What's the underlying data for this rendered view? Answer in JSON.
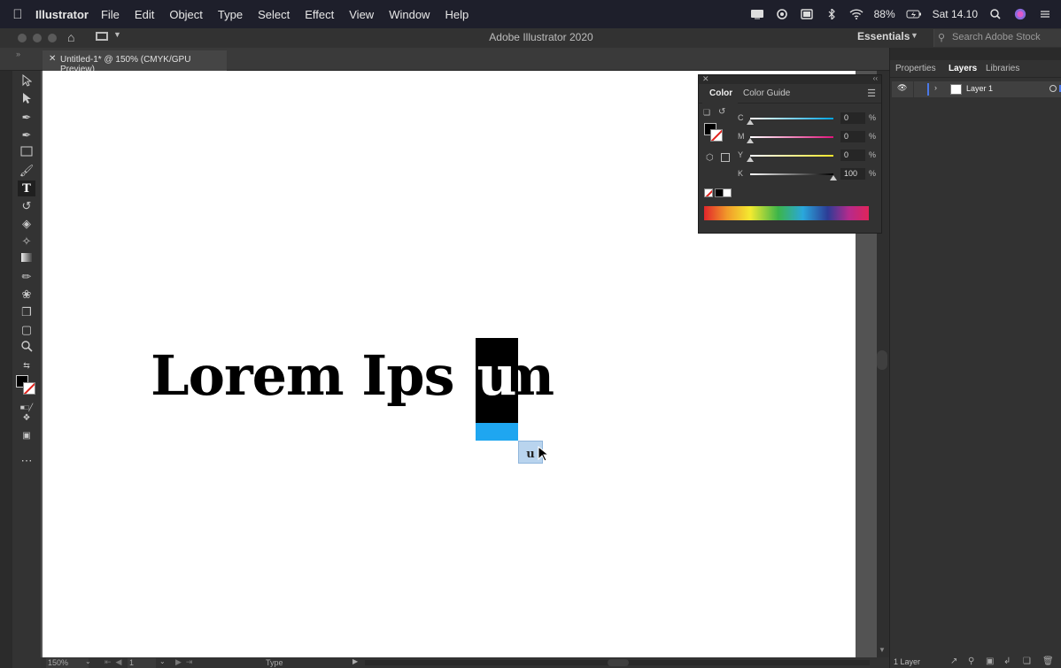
{
  "menubar": {
    "app_name": "Illustrator",
    "items": [
      "File",
      "Edit",
      "Object",
      "Type",
      "Select",
      "Effect",
      "View",
      "Window",
      "Help"
    ],
    "battery": "88%",
    "clock": "Sat 14.10"
  },
  "titlebar": {
    "title": "Adobe Illustrator 2020",
    "workspace": "Essentials",
    "stock_placeholder": "Search Adobe Stock"
  },
  "document_tab": {
    "label": "Untitled-1* @ 150% (CMYK/GPU Preview)"
  },
  "canvas": {
    "text_before": "Lorem Ips",
    "selected_letter": "u",
    "text_after": "m",
    "drag_glyph": "u"
  },
  "color_panel": {
    "tabs": [
      "Color",
      "Color Guide"
    ],
    "channels": [
      {
        "label": "C",
        "value": "0",
        "unit": "%",
        "level": 0
      },
      {
        "label": "M",
        "value": "0",
        "unit": "%",
        "level": 0
      },
      {
        "label": "Y",
        "value": "0",
        "unit": "%",
        "level": 0
      },
      {
        "label": "K",
        "value": "100",
        "unit": "%",
        "level": 1
      }
    ]
  },
  "right_dock": {
    "tabs": [
      "Properties",
      "Layers",
      "Libraries"
    ],
    "active_tab": "Layers",
    "layers": [
      {
        "name": "Layer 1"
      }
    ],
    "layer_count": "1 Layer"
  },
  "statusbar": {
    "zoom": "150%",
    "page": "1",
    "tool": "Type"
  },
  "colors": {
    "selection_blue": "#1fa6f0",
    "layer_blue": "#4b78e8"
  }
}
